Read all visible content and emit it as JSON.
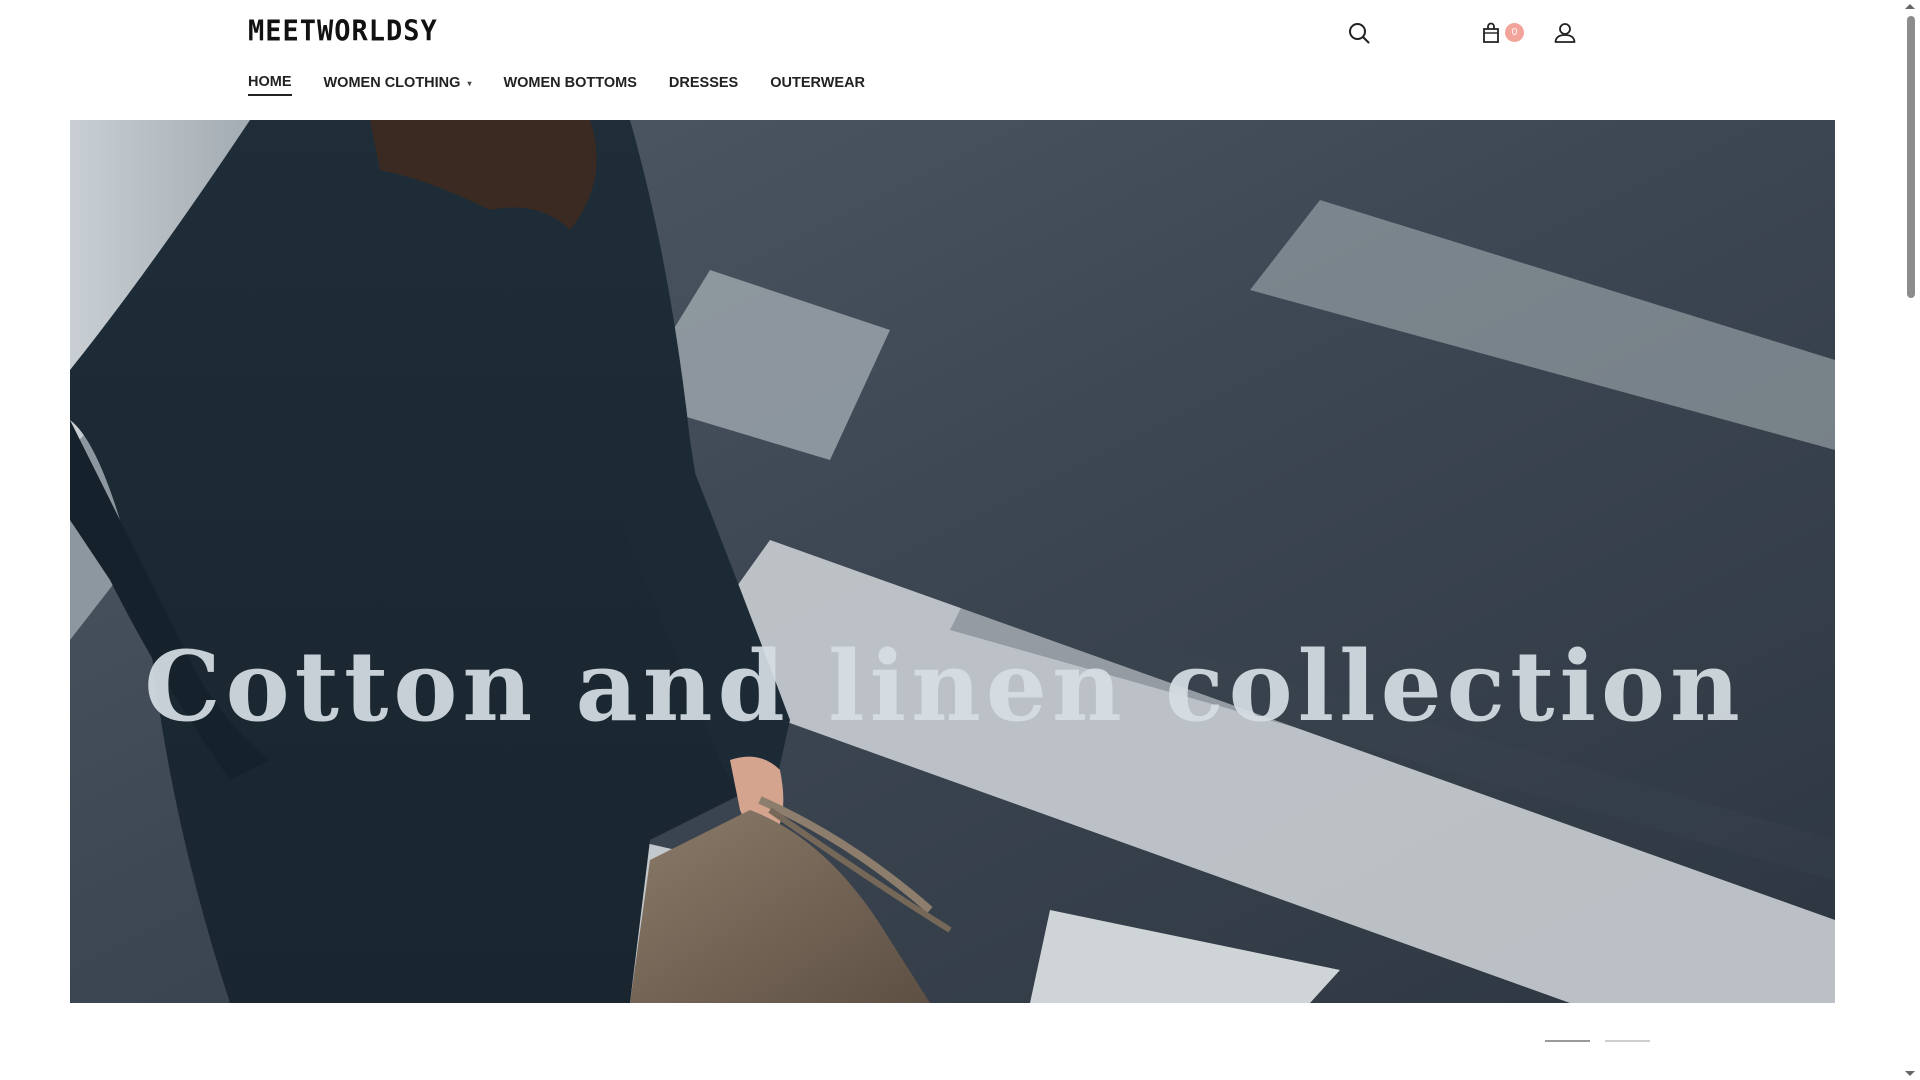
{
  "header": {
    "logo_text": "MEETWORLDSY",
    "cart_count": "0",
    "icons": {
      "search": "search-icon",
      "cart": "shopping-bag-icon",
      "account": "user-icon"
    }
  },
  "nav": {
    "items": [
      {
        "label": "HOME",
        "active": true
      },
      {
        "label": "WOMEN CLOTHING",
        "has_dropdown": true
      },
      {
        "label": "WOMEN BOTTOMS"
      },
      {
        "label": "DRESSES"
      },
      {
        "label": "OUTERWEAR"
      }
    ]
  },
  "hero": {
    "title": "Cotton and linen collection"
  },
  "slider": {
    "slides": 2,
    "active_index": 0
  },
  "colors": {
    "badge": "#f2a49b",
    "hero_text": "#d6dee4"
  }
}
